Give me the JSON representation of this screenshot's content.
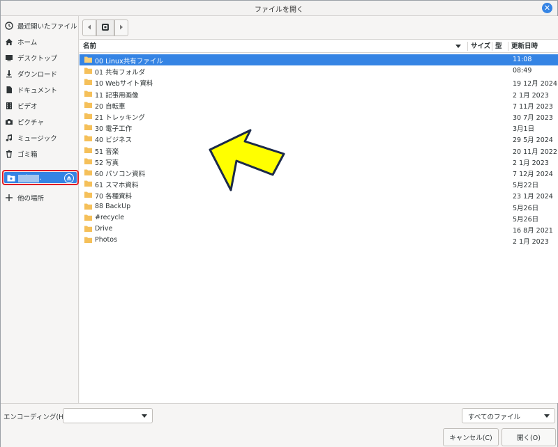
{
  "window": {
    "title": "ファイルを開く",
    "close_glyph": "✕"
  },
  "sidebar": {
    "items": [
      {
        "label": "最近開いたファイル",
        "icon": "clock-icon"
      },
      {
        "label": "ホーム",
        "icon": "home-icon"
      },
      {
        "label": "デスクトップ",
        "icon": "desktop-icon"
      },
      {
        "label": "ダウンロード",
        "icon": "download-icon"
      },
      {
        "label": "ドキュメント",
        "icon": "document-icon"
      },
      {
        "label": "ビデオ",
        "icon": "video-icon"
      },
      {
        "label": "ピクチャ",
        "icon": "camera-icon"
      },
      {
        "label": "ミュージック",
        "icon": "music-icon"
      },
      {
        "label": "ゴミ箱",
        "icon": "trash-icon"
      }
    ],
    "network_item": {
      "label": "loc...",
      "icon": "network-folder-icon",
      "eject_icon": "eject-icon"
    },
    "other_locations": {
      "label": "他の場所",
      "icon": "plus-icon"
    }
  },
  "pathbar": {
    "back_icon": "chevron-left-icon",
    "current_icon": "drive-icon",
    "forward_icon": "chevron-right-icon"
  },
  "list": {
    "columns": {
      "name": "名前",
      "size": "サイズ",
      "type": "型",
      "modified": "更新日時"
    },
    "rows": [
      {
        "name": "00 Linux共有ファイル",
        "modified": "11:08",
        "selected": true
      },
      {
        "name": "01 共有フォルダ",
        "modified": "08:49"
      },
      {
        "name": "10 Webサイト資料",
        "modified": "19 12月 2024"
      },
      {
        "name": "11 記事用画像",
        "modified": "2 1月 2023"
      },
      {
        "name": "20 自転車",
        "modified": "7 11月 2023"
      },
      {
        "name": "21 トレッキング",
        "modified": "30 7月 2023"
      },
      {
        "name": "30 電子工作",
        "modified": "3月1日"
      },
      {
        "name": "40 ビジネス",
        "modified": "29 5月 2024"
      },
      {
        "name": "51 音楽",
        "modified": "20 11月 2022"
      },
      {
        "name": "52 写真",
        "modified": "2 1月 2023"
      },
      {
        "name": "60 パソコン資料",
        "modified": "7 12月 2024"
      },
      {
        "name": "61 スマホ資料",
        "modified": "5月22日"
      },
      {
        "name": "70 各種資料",
        "modified": "23 1月 2024"
      },
      {
        "name": "88 BackUp",
        "modified": "5月26日"
      },
      {
        "name": "#recycle",
        "modified": "5月26日"
      },
      {
        "name": "Drive",
        "modified": "16 8月 2021"
      },
      {
        "name": "Photos",
        "modified": "2 1月 2023"
      }
    ]
  },
  "footer": {
    "encoding_label": "エンコーディング(H):",
    "encoding_value": "",
    "filter_value": "すべてのファイル",
    "cancel_label": "キャンセル(C)",
    "open_label": "開く(O)"
  },
  "colors": {
    "accent": "#3584e4",
    "folder": "#f5c05a",
    "highlight_border": "#e01b24",
    "arrow_fill": "#ffff00",
    "arrow_stroke": "#1c2a4a"
  }
}
